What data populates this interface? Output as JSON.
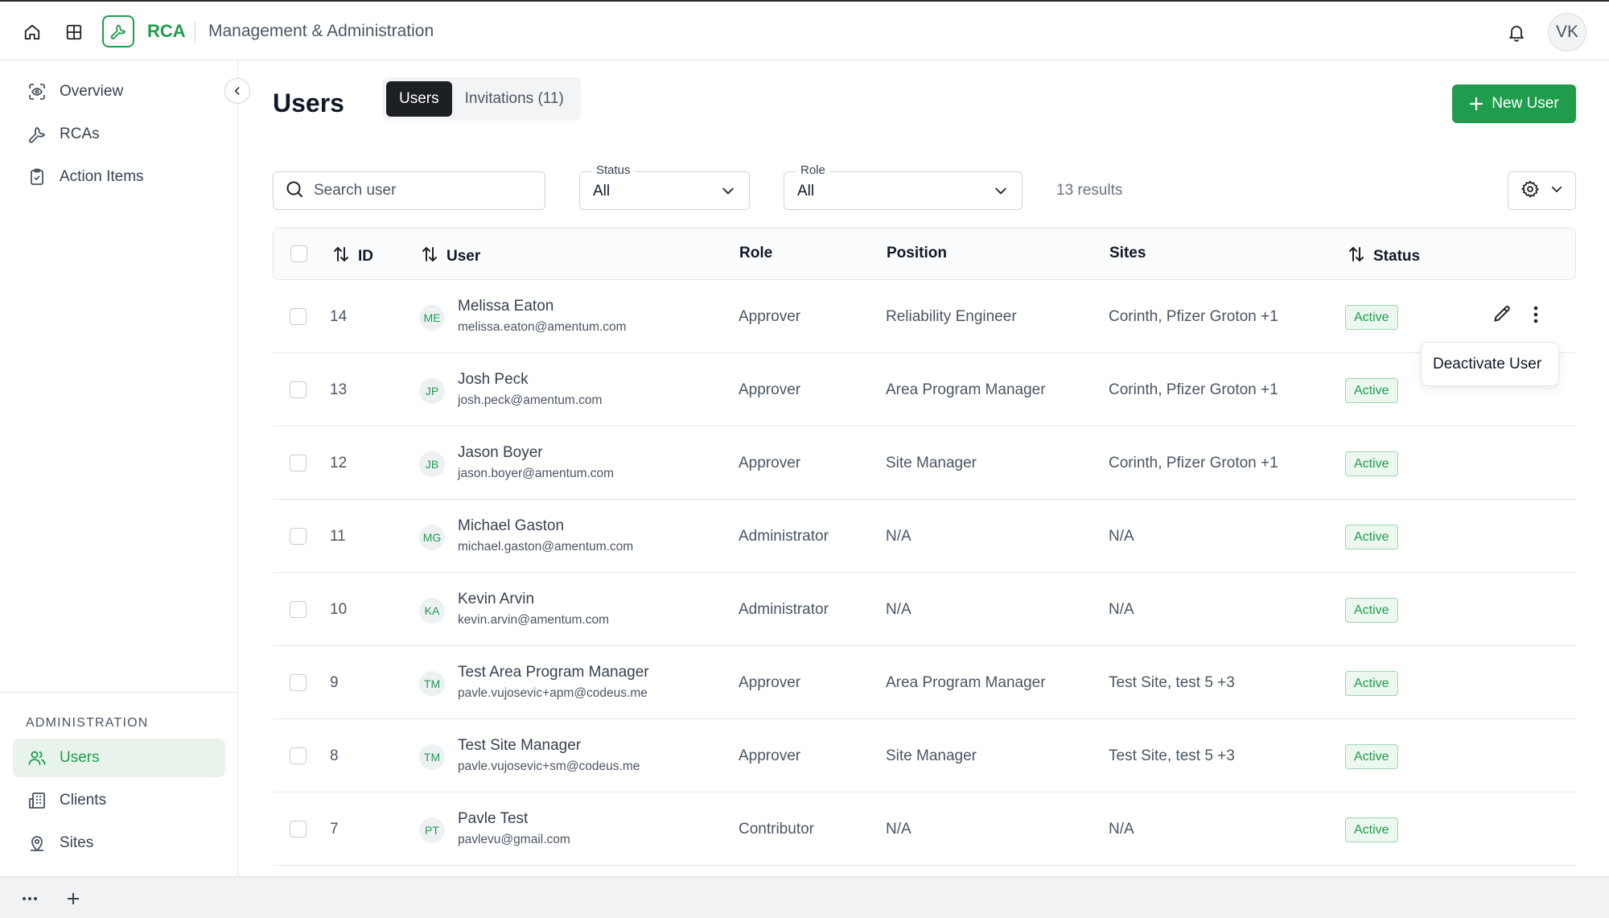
{
  "app": {
    "brand": "RCA",
    "section": "Management & Administration",
    "user_initials": "VK",
    "accent_color": "#1f9d4c"
  },
  "sidebar": {
    "items": [
      {
        "label": "Overview",
        "icon": "overview-icon"
      },
      {
        "label": "RCAs",
        "icon": "wrench-icon"
      },
      {
        "label": "Action Items",
        "icon": "clipboard-icon"
      }
    ],
    "admin_heading": "ADMINISTRATION",
    "admin_items": [
      {
        "label": "Users",
        "icon": "users-icon",
        "active": true
      },
      {
        "label": "Clients",
        "icon": "building-icon"
      },
      {
        "label": "Sites",
        "icon": "location-icon"
      }
    ]
  },
  "header": {
    "title": "Users",
    "tabs": [
      {
        "label": "Users",
        "active": true
      },
      {
        "label": "Invitations (11)"
      }
    ],
    "new_user_label": "New User"
  },
  "filters": {
    "search_placeholder": "Search user",
    "status": {
      "label": "Status",
      "value": "All"
    },
    "role": {
      "label": "Role",
      "value": "All"
    },
    "results": "13 results"
  },
  "table": {
    "columns": {
      "id": "ID",
      "user": "User",
      "role": "Role",
      "position": "Position",
      "sites": "Sites",
      "status": "Status"
    },
    "rows": [
      {
        "id": "14",
        "initials": "ME",
        "name": "Melissa Eaton",
        "email": "melissa.eaton@amentum.com",
        "role": "Approver",
        "position": "Reliability Engineer",
        "sites": "Corinth, Pfizer Groton +1",
        "status": "Active"
      },
      {
        "id": "13",
        "initials": "JP",
        "name": "Josh Peck",
        "email": "josh.peck@amentum.com",
        "role": "Approver",
        "position": "Area Program Manager",
        "sites": "Corinth, Pfizer Groton +1",
        "status": "Active"
      },
      {
        "id": "12",
        "initials": "JB",
        "name": "Jason Boyer",
        "email": "jason.boyer@amentum.com",
        "role": "Approver",
        "position": "Site Manager",
        "sites": "Corinth, Pfizer Groton +1",
        "status": "Active"
      },
      {
        "id": "11",
        "initials": "MG",
        "name": "Michael Gaston",
        "email": "michael.gaston@amentum.com",
        "role": "Administrator",
        "position": "N/A",
        "sites": "N/A",
        "status": "Active"
      },
      {
        "id": "10",
        "initials": "KA",
        "name": "Kevin Arvin",
        "email": "kevin.arvin@amentum.com",
        "role": "Administrator",
        "position": "N/A",
        "sites": "N/A",
        "status": "Active"
      },
      {
        "id": "9",
        "initials": "TM",
        "name": "Test Area Program Manager",
        "email": "pavle.vujosevic+apm@codeus.me",
        "role": "Approver",
        "position": "Area Program Manager",
        "sites": "Test Site, test 5 +3",
        "status": "Active"
      },
      {
        "id": "8",
        "initials": "TM",
        "name": "Test Site Manager",
        "email": "pavle.vujosevic+sm@codeus.me",
        "role": "Approver",
        "position": "Site Manager",
        "sites": "Test Site, test 5 +3",
        "status": "Active"
      },
      {
        "id": "7",
        "initials": "PT",
        "name": "Pavle Test",
        "email": "pavlevu@gmail.com",
        "role": "Contributor",
        "position": "N/A",
        "sites": "N/A",
        "status": "Active"
      }
    ]
  },
  "row_menu": {
    "deactivate_label": "Deactivate User"
  }
}
